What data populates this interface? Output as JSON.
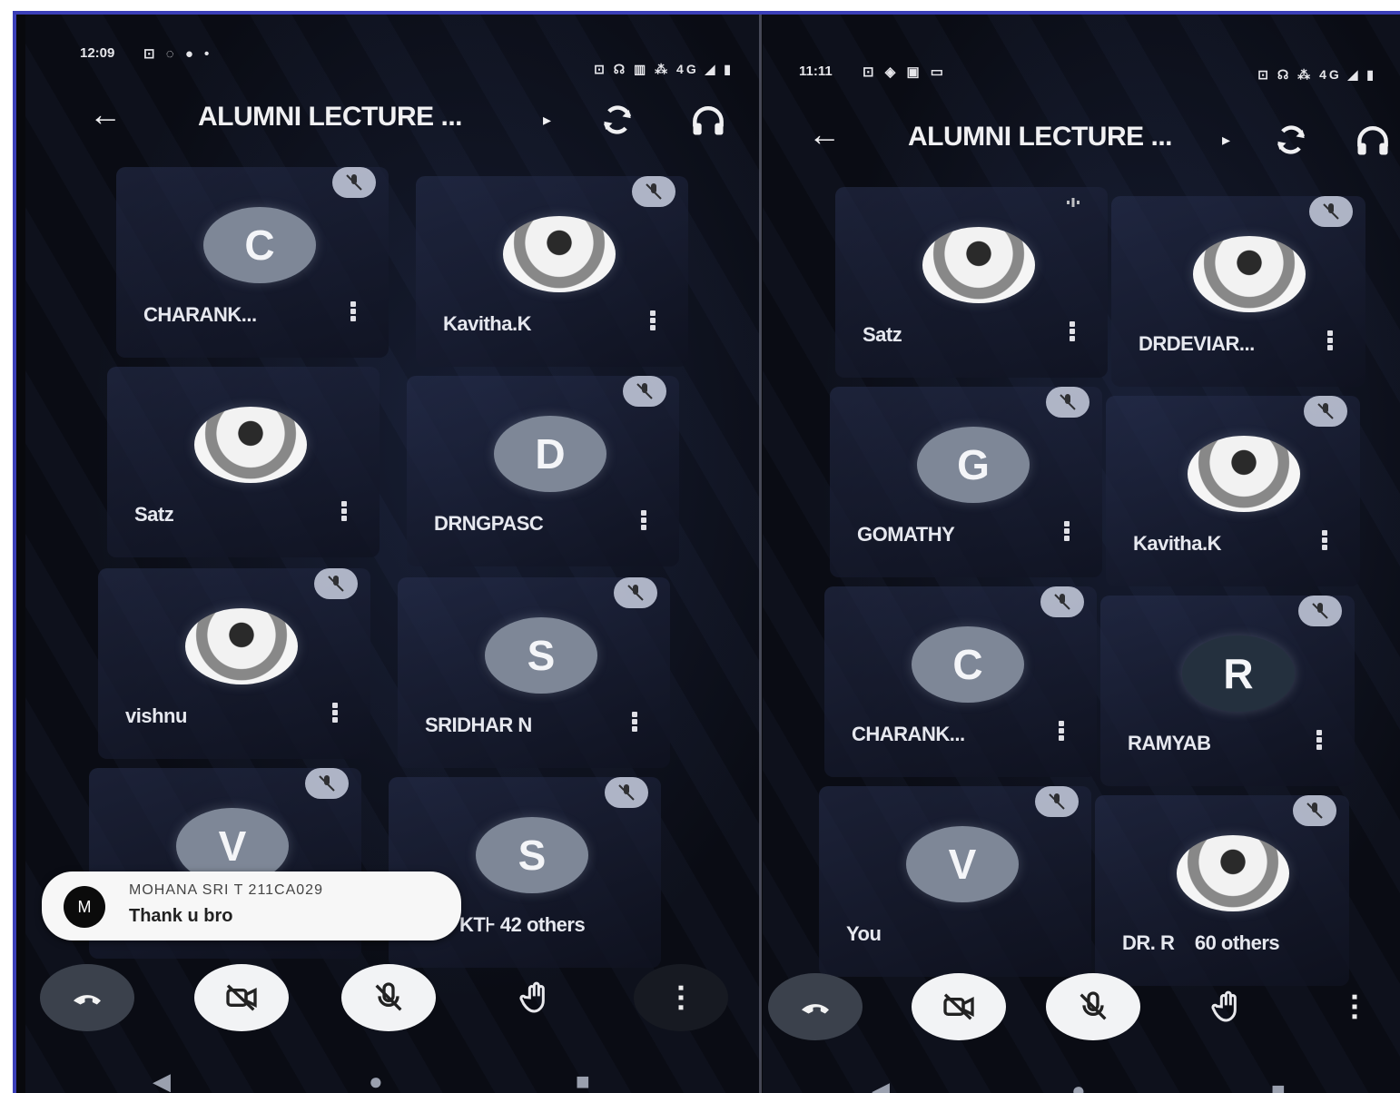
{
  "left_phone": {
    "status": {
      "time": "12:09",
      "left_icons": "⊡ ◌ ● •",
      "right_icons": "⊡ ☊ ▥ ⁂ 4G ◢ ▮"
    },
    "header": {
      "title": "ALUMNI LECTURE ...",
      "caret": "▸"
    },
    "tiles": [
      {
        "initial": "C",
        "name": "CHARANK..."
      },
      {
        "initial": "",
        "name": "Kavitha.K"
      },
      {
        "initial": "",
        "name": "Satz"
      },
      {
        "initial": "D",
        "name": "DRNGPASC"
      },
      {
        "initial": "",
        "name": "vishnu"
      },
      {
        "initial": "S",
        "name": "SRIDHAR N"
      },
      {
        "initial": "V",
        "name": ""
      },
      {
        "initial": "S",
        "name": "KT⊦  42 others"
      }
    ],
    "toast": {
      "avatar": "M",
      "sender": "MOHANA SRI T 211CA029",
      "message": "Thank u bro"
    },
    "navbar": {
      "back": "◀",
      "home": "●",
      "recent": "■"
    }
  },
  "right_phone": {
    "status": {
      "time": "11:11",
      "left_icons": "⊡ ◈ ▣ ▭",
      "right_icons": "⊡ ☊ ⁂ 4G ◢ ▮"
    },
    "header": {
      "title": "ALUMNI LECTURE ...",
      "caret": "▸"
    },
    "tiles": [
      {
        "initial": "",
        "name": "Satz"
      },
      {
        "initial": "",
        "name": "DRDEVIAR..."
      },
      {
        "initial": "G",
        "name": "GOMATHY"
      },
      {
        "initial": "",
        "name": "Kavitha.K"
      },
      {
        "initial": "C",
        "name": "CHARANK..."
      },
      {
        "initial": "R",
        "name": "RAMYAB"
      },
      {
        "initial": "V",
        "name": "You"
      },
      {
        "initial": "",
        "name": "DR. R    60 others"
      }
    ],
    "navbar": {
      "back": "◀",
      "home": "●",
      "recent": "■"
    }
  }
}
